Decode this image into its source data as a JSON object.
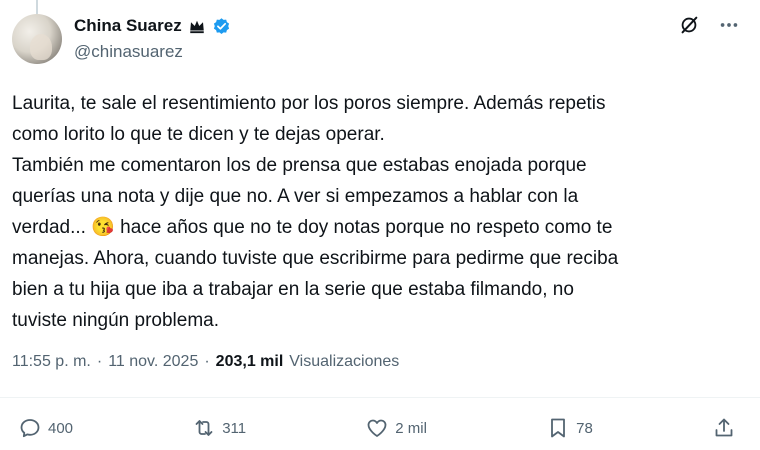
{
  "author": {
    "display_name": "China Suarez",
    "handle": "@chinasuarez",
    "badge_icon": "crown-icon",
    "verified_icon": "verified-icon",
    "verified_color": "#1d9bf0"
  },
  "tweet": {
    "text": "Laurita, te sale el resentimiento por los poros siempre. Además repetis\ncomo lorito lo que te dicen y te dejas operar.\nTambién me comentaron los de prensa que estabas enojada porque\nquerías una nota y dije que no. A ver si empezamos a hablar con la\nverdad... 😘 hace años que no te doy notas porque no respeto como te\nmanejas. Ahora, cuando tuviste que escribirme para pedirme que reciba\nbien a tu hija que iba a trabajar en la serie que estaba filmando, no\ntuviste ningún problema."
  },
  "meta": {
    "time": "11:55 p. m.",
    "date": "11 nov. 2025",
    "separator": "·",
    "views_count": "203,1 mil",
    "views_label": "Visualizaciones"
  },
  "actions": {
    "replies": "400",
    "reposts": "311",
    "likes": "2 mil",
    "bookmarks": "78"
  },
  "colors": {
    "text_primary": "#0f1419",
    "text_secondary": "#536471",
    "repost_green": "#00ba7c"
  }
}
